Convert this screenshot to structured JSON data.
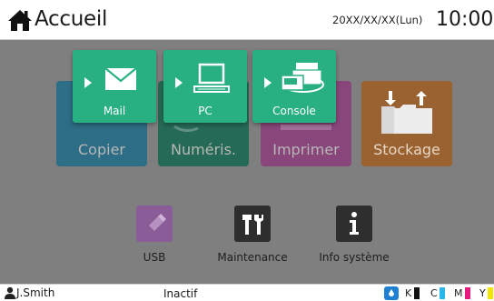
{
  "header": {
    "title": "Accueil",
    "date": "20XX/XX/XX(Lun)",
    "time": "10:00"
  },
  "main_tiles": [
    {
      "label": "Copier",
      "color": "#2d6d85"
    },
    {
      "label": "Numéris.",
      "color": "#256a55"
    },
    {
      "label": "Imprimer",
      "color": "#88467a"
    },
    {
      "label": "Stockage",
      "color": "#996230"
    }
  ],
  "popup": {
    "color": "#28b082",
    "items": [
      {
        "label": "Mail",
        "icon": "envelope-icon"
      },
      {
        "label": "PC",
        "icon": "computer-icon"
      },
      {
        "label": "Console",
        "icon": "console-icon"
      }
    ]
  },
  "small_tiles": [
    {
      "label": "USB",
      "icon": "usb-icon"
    },
    {
      "label": "Maintenance",
      "icon": "maintenance-icon"
    },
    {
      "label": "Info système",
      "icon": "info-icon"
    }
  ],
  "footer": {
    "user": "J.Smith",
    "status": "Inactif",
    "inks": [
      {
        "label": "K",
        "color": "#000000"
      },
      {
        "label": "C",
        "color": "#29b6e8"
      },
      {
        "label": "M",
        "color": "#e6197f"
      },
      {
        "label": "Y",
        "color": "#f3e600"
      }
    ]
  }
}
